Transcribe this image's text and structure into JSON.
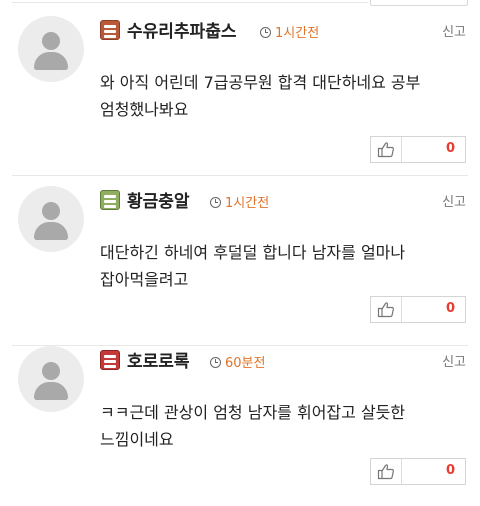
{
  "comments": [
    {
      "nickname": "수유리추파춥스",
      "time": "1시간전",
      "report": "신고",
      "body": "와 아직 어린데 7급공무원 합격 대단하네요 공부 엄청했나봐요",
      "likes": "0",
      "level_icon": "level-badge-brown",
      "level_color": "#b85a3a"
    },
    {
      "nickname": "황금충알",
      "time": "1시간전",
      "report": "신고",
      "body": "대단하긴 하네여 후덜덜 합니다 남자를 얼마나 잡아먹을려고",
      "likes": "0",
      "level_icon": "level-badge-green",
      "level_color": "#6b8a45"
    },
    {
      "nickname": "호로로록",
      "time": "60분전",
      "report": "신고",
      "body": "ㅋㅋ근데 관상이 엄청 남자를 휘어잡고 살듯한 느낌이네요",
      "likes": "0",
      "level_icon": "level-badge-red",
      "level_color": "#c23a3a"
    }
  ],
  "icons": {
    "avatar": "user-silhouette-icon",
    "time": "clock-icon",
    "like": "thumbs-up-icon"
  },
  "colors": {
    "time_text": "#e0742a",
    "like_count": "#e63c2f"
  }
}
